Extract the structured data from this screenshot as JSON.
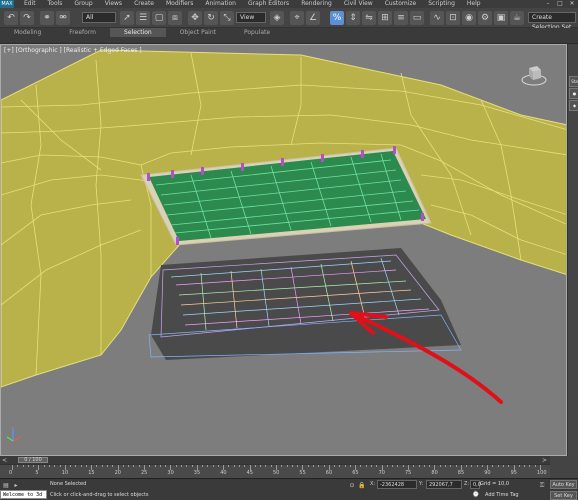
{
  "menu": {
    "logo": "MAX",
    "items": [
      "Edit",
      "Tools",
      "Group",
      "Views",
      "Create",
      "Modifiers",
      "Animation",
      "Graph Editors",
      "Rendering",
      "Civil View",
      "Customize",
      "Scripting",
      "Help"
    ]
  },
  "toolbar": {
    "filter_value": "All",
    "view_value": "View",
    "selection_set_placeholder": "Create Selection Set"
  },
  "ribbon": {
    "tabs": [
      "Modeling",
      "Freeform",
      "Selection",
      "Object Paint",
      "Populate"
    ],
    "selected": "Selection"
  },
  "viewport": {
    "label": "[+] [Orthographic ] [Realistic + Edged Faces ]",
    "colors": {
      "background": "#7d7d7d",
      "terrain": "#b9b24a",
      "terrain_edge": "#e6e07a",
      "hedge": "#2d8a4f",
      "base": "#d9d2b4",
      "shadow": "#4a4a4a",
      "arrow": "#e0101a"
    }
  },
  "timeline": {
    "slider_label": "0 / 100",
    "ticks": [
      "0",
      "5",
      "10",
      "15",
      "20",
      "25",
      "30",
      "35",
      "40",
      "45",
      "50",
      "55",
      "60",
      "65",
      "70",
      "75",
      "80",
      "85",
      "90",
      "95",
      "100"
    ]
  },
  "status": {
    "script_listener": "Welcome to 3d",
    "selection": "None Selected",
    "prompt": "Click or click-and-drag to select objects",
    "x_label": "X:",
    "x_value": "-2362428",
    "y_label": "Y:",
    "y_value": "292067,7",
    "z_label": "Z:",
    "z_value": "0,0",
    "grid": "Grid = 10,0",
    "add_time_tag": "Add Time Tag",
    "auto_key": "Auto Key",
    "set_key": "Set Key"
  },
  "right_panel": {
    "tab_label": "Sta"
  }
}
